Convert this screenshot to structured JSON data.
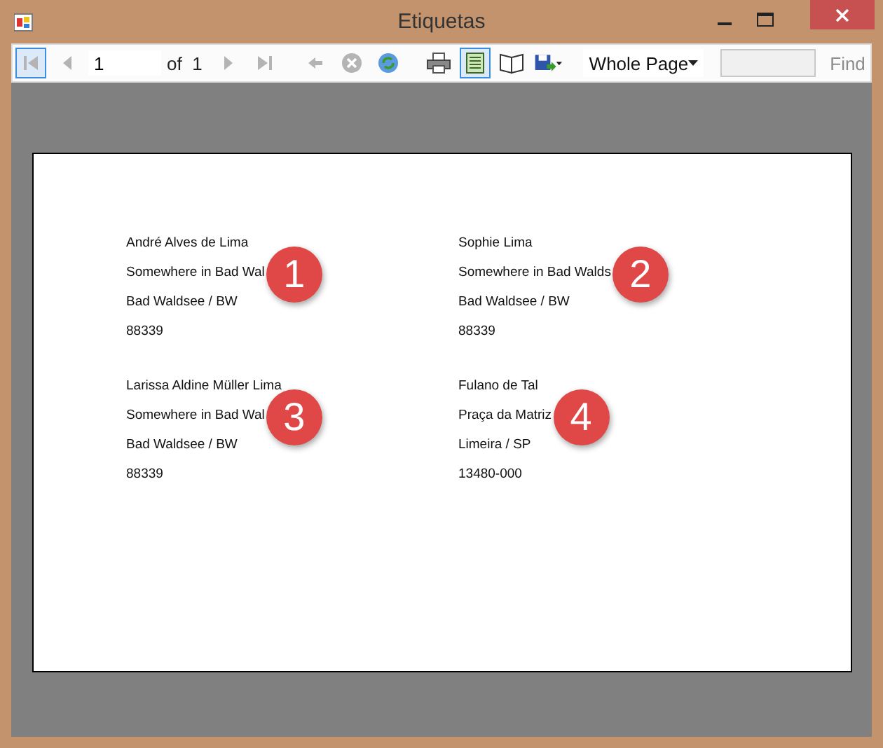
{
  "window": {
    "title": "Etiquetas"
  },
  "toolbar": {
    "items": [
      {
        "kind": "first",
        "disabled": true,
        "active": true
      },
      {
        "kind": "prev",
        "disabled": true,
        "active": false
      },
      {
        "kind": "page",
        "value": "1",
        "of_label": "of",
        "total": "1"
      },
      {
        "kind": "next",
        "disabled": true,
        "active": false
      },
      {
        "kind": "last",
        "disabled": true,
        "active": false
      },
      {
        "kind": "sep"
      },
      {
        "kind": "back",
        "disabled": true,
        "active": false
      },
      {
        "kind": "stop",
        "disabled": true,
        "active": false
      },
      {
        "kind": "refresh",
        "active": false
      },
      {
        "kind": "sep"
      },
      {
        "kind": "print",
        "active": false
      },
      {
        "kind": "layout",
        "active": true
      },
      {
        "kind": "setup",
        "active": false
      },
      {
        "kind": "export",
        "active": false
      },
      {
        "kind": "sep"
      },
      {
        "kind": "zoom",
        "value": "Whole Page"
      },
      {
        "kind": "find",
        "label": "Find",
        "disabled": true
      }
    ]
  },
  "labels": [
    {
      "lines": [
        "André Alves de Lima",
        "Somewhere in Bad Wal",
        "Bad Waldsee / BW",
        "88339"
      ],
      "badge": "1"
    },
    {
      "lines": [
        "Sophie Lima",
        "Somewhere in Bad Walds",
        "Bad Waldsee / BW",
        "88339"
      ],
      "badge": "2"
    },
    {
      "lines": [
        "Larissa Aldine Müller Lima",
        "Somewhere in Bad Wal",
        "Bad Waldsee / BW",
        "88339"
      ],
      "badge": "3"
    },
    {
      "lines": [
        "Fulano de Tal",
        "Praça da Matriz",
        "Limeira / SP",
        "13480-000"
      ],
      "badge": "4"
    }
  ]
}
